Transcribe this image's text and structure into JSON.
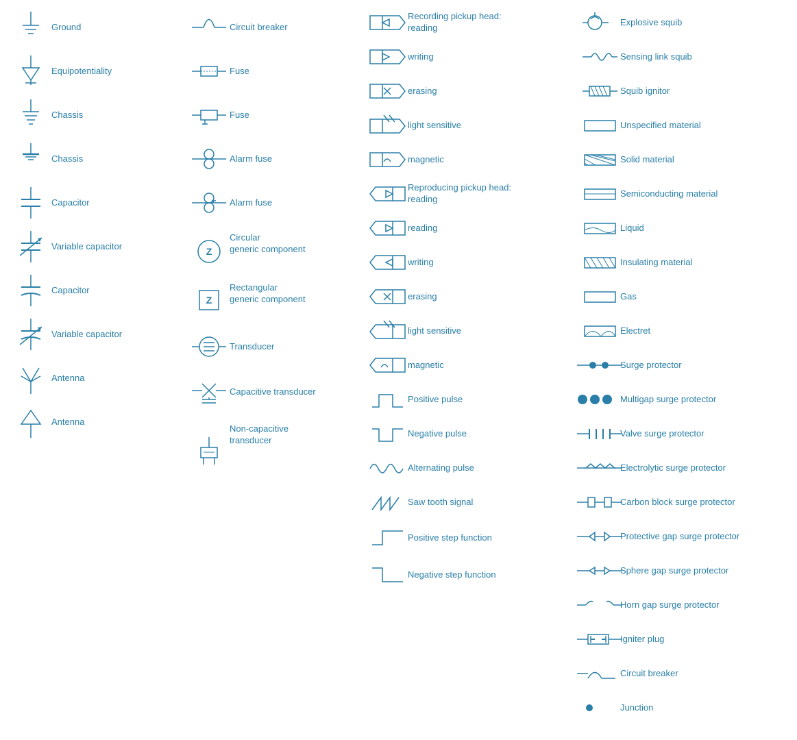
{
  "columns": [
    {
      "id": "col1",
      "items": [
        {
          "id": "ground",
          "label": "Ground",
          "symbol": "ground"
        },
        {
          "id": "equipotentiality",
          "label": "Equipotentiality",
          "symbol": "equipotentiality"
        },
        {
          "id": "chassis1",
          "label": "Chassis",
          "symbol": "chassis1"
        },
        {
          "id": "chassis2",
          "label": "Chassis",
          "symbol": "chassis2"
        },
        {
          "id": "capacitor1",
          "label": "Capacitor",
          "symbol": "capacitor1"
        },
        {
          "id": "variable-capacitor1",
          "label": "Variable capacitor",
          "symbol": "variable-capacitor1"
        },
        {
          "id": "capacitor2",
          "label": "Capacitor",
          "symbol": "capacitor2"
        },
        {
          "id": "variable-capacitor2",
          "label": "Variable capacitor",
          "symbol": "variable-capacitor2"
        },
        {
          "id": "antenna1",
          "label": "Antenna",
          "symbol": "antenna1"
        },
        {
          "id": "antenna2",
          "label": "Antenna",
          "symbol": "antenna2"
        }
      ]
    },
    {
      "id": "col2",
      "items": [
        {
          "id": "circuit-breaker",
          "label": "Circuit breaker",
          "symbol": "circuit-breaker"
        },
        {
          "id": "fuse1",
          "label": "Fuse",
          "symbol": "fuse1"
        },
        {
          "id": "fuse2",
          "label": "Fuse",
          "symbol": "fuse2"
        },
        {
          "id": "alarm-fuse1",
          "label": "Alarm fuse",
          "symbol": "alarm-fuse1"
        },
        {
          "id": "alarm-fuse2",
          "label": "Alarm fuse",
          "symbol": "alarm-fuse2"
        },
        {
          "id": "circular-generic",
          "label": "Circular\ngeneric component",
          "symbol": "circular-generic",
          "tall": true
        },
        {
          "id": "rectangular-generic",
          "label": "Rectangular\ngeneric component",
          "symbol": "rectangular-generic",
          "tall": true
        },
        {
          "id": "transducer",
          "label": "Transducer",
          "symbol": "transducer"
        },
        {
          "id": "capacitive-transducer",
          "label": "Capacitive transducer",
          "symbol": "capacitive-transducer"
        },
        {
          "id": "non-capacitive-transducer",
          "label": "Non-capacitive\ntransducer",
          "symbol": "non-capacitive-transducer",
          "tall": true
        }
      ]
    },
    {
      "id": "col3",
      "items": [
        {
          "id": "rec-reading",
          "label": "Recording pickup head:",
          "symbol": "rec-head-reading",
          "sublabel": "reading"
        },
        {
          "id": "rec-writing",
          "label": "writing",
          "symbol": "rec-head-writing"
        },
        {
          "id": "rec-erasing",
          "label": "erasing",
          "symbol": "rec-head-erasing"
        },
        {
          "id": "rec-light",
          "label": "light sensitive",
          "symbol": "rec-head-light"
        },
        {
          "id": "rec-magnetic",
          "label": "magnetic",
          "symbol": "rec-head-magnetic"
        },
        {
          "id": "rep-reading",
          "label": "Reproducing pickup head:",
          "symbol": "rep-head-reading",
          "sublabel": "reading"
        },
        {
          "id": "rep-writing2",
          "label": "reading",
          "symbol": "rep-head-reading2"
        },
        {
          "id": "rep-writing",
          "label": "writing",
          "symbol": "rep-head-writing"
        },
        {
          "id": "rep-erasing",
          "label": "erasing",
          "symbol": "rep-head-erasing"
        },
        {
          "id": "rep-light",
          "label": "light sensitive",
          "symbol": "rep-head-light"
        },
        {
          "id": "rep-magnetic",
          "label": "magnetic",
          "symbol": "rep-head-magnetic"
        },
        {
          "id": "positive-pulse",
          "label": "Positive pulse",
          "symbol": "positive-pulse"
        },
        {
          "id": "negative-pulse",
          "label": "Negative pulse",
          "symbol": "negative-pulse"
        },
        {
          "id": "alternating-pulse",
          "label": "Alternating pulse",
          "symbol": "alternating-pulse"
        },
        {
          "id": "saw-tooth",
          "label": "Saw tooth signal",
          "symbol": "saw-tooth"
        },
        {
          "id": "positive-step",
          "label": "Positive step function",
          "symbol": "positive-step"
        },
        {
          "id": "negative-step",
          "label": "Negative step function",
          "symbol": "negative-step"
        }
      ]
    },
    {
      "id": "col4",
      "items": [
        {
          "id": "explosive-squib",
          "label": "Explosive squib",
          "symbol": "explosive-squib"
        },
        {
          "id": "sensing-link-squib",
          "label": "Sensing link squib",
          "symbol": "sensing-link-squib"
        },
        {
          "id": "squib-ignitor",
          "label": "Squib ignitor",
          "symbol": "squib-ignitor"
        },
        {
          "id": "unspecified-material",
          "label": "Unspecified material",
          "symbol": "unspecified-material"
        },
        {
          "id": "solid-material",
          "label": "Solid material",
          "symbol": "solid-material"
        },
        {
          "id": "semiconducting-material",
          "label": "Semiconducting material",
          "symbol": "semiconducting-material"
        },
        {
          "id": "liquid",
          "label": "Liquid",
          "symbol": "liquid"
        },
        {
          "id": "insulating-material",
          "label": "Insulating material",
          "symbol": "insulating-material"
        },
        {
          "id": "gas",
          "label": "Gas",
          "symbol": "gas"
        },
        {
          "id": "electret",
          "label": "Electret",
          "symbol": "electret"
        },
        {
          "id": "surge-protector",
          "label": "Surge protector",
          "symbol": "surge-protector"
        },
        {
          "id": "multigap-surge",
          "label": "Multigap surge protector",
          "symbol": "multigap-surge"
        },
        {
          "id": "valve-surge",
          "label": "Valve surge protector",
          "symbol": "valve-surge"
        },
        {
          "id": "electrolytic-surge",
          "label": "Electrolytic surge protector",
          "symbol": "electrolytic-surge"
        },
        {
          "id": "carbon-block-surge",
          "label": "Carbon block surge protector",
          "symbol": "carbon-block-surge"
        },
        {
          "id": "protective-gap-surge",
          "label": "Protective gap surge protector",
          "symbol": "protective-gap-surge"
        },
        {
          "id": "sphere-gap-surge",
          "label": "Sphere gap surge protector",
          "symbol": "sphere-gap-surge"
        },
        {
          "id": "horn-gap-surge",
          "label": "Horn gap surge protector",
          "symbol": "horn-gap-surge"
        },
        {
          "id": "igniter-plug",
          "label": "Igniter plug",
          "symbol": "igniter-plug"
        },
        {
          "id": "circuit-breaker2",
          "label": "Circuit breaker",
          "symbol": "circuit-breaker2"
        },
        {
          "id": "junction",
          "label": "Junction",
          "symbol": "junction"
        }
      ]
    }
  ]
}
